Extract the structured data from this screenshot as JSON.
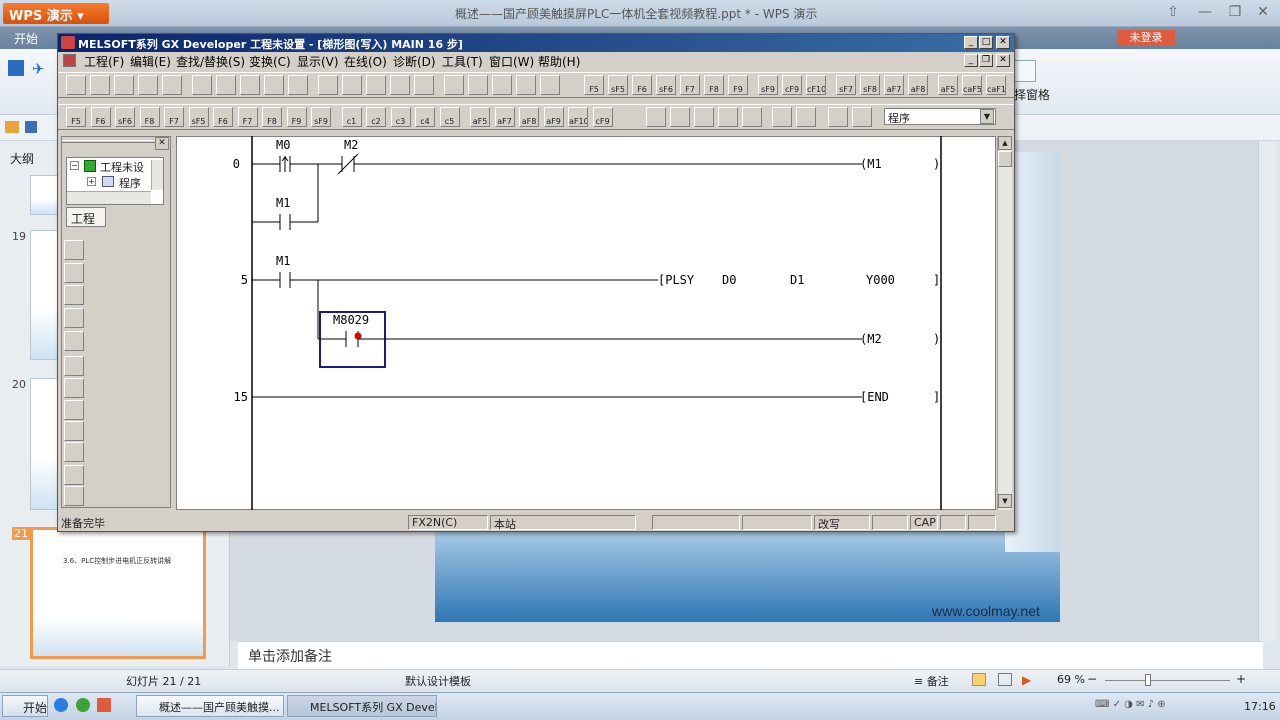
{
  "wps": {
    "app_button": "WPS 演示",
    "doc_title": "概述——国产顾美触摸屏PLC一体机全套视频教程.ppt * - WPS 演示",
    "menu_start": "开始",
    "login": "未登录",
    "ribbon_right_label": "择窗格",
    "outline_tab": "大纲",
    "slide_numbers": [
      "19",
      "20",
      "21"
    ],
    "thumb21_title": "3.6、PLC控制步进电机正反转讲解",
    "slide_site": "www.coolmay.net",
    "notes_placeholder": "单击添加备注",
    "status_slide": "幻灯片 21 / 21",
    "status_template": "默认设计模板",
    "status_notes": "备注",
    "zoom": "69 %"
  },
  "taskbar": {
    "start": "开始",
    "item1": "概述——国产顾美触摸...",
    "item2": "MELSOFT系列 GX Devel...",
    "clock": "17:16"
  },
  "gx": {
    "title": "MELSOFT系列 GX Developer 工程未设置 - [梯形图(写入)    MAIN    16 步]",
    "menu": [
      "工程(F)",
      "编辑(E)",
      "查找/替换(S)",
      "变换(C)",
      "显示(V)",
      "在线(O)",
      "诊断(D)",
      "工具(T)",
      "窗口(W)",
      "帮助(H)"
    ],
    "toolbar_keys": [
      "F5",
      "sF5",
      "F6",
      "sF6",
      "F7",
      "F8",
      "F9",
      "sF9",
      "cF9",
      "cF10",
      "sF7",
      "sF8",
      "aF7",
      "aF8",
      "aF5",
      "caF5",
      "caF10"
    ],
    "toolbar2_keys": [
      "F5",
      "F6",
      "sF6",
      "F8",
      "F7",
      "sF5",
      "F6",
      "F7",
      "F8",
      "F9",
      "sF9",
      "c1",
      "c2",
      "c3",
      "c4",
      "c5",
      "aF5",
      "aF7",
      "aF8",
      "aF9",
      "aF10",
      "cF9"
    ],
    "mode": "程序",
    "project": {
      "root": "工程未设",
      "child": "程序",
      "tab": "工程"
    },
    "ladder": {
      "steps": [
        "0",
        "5",
        "15"
      ],
      "contacts": {
        "r0_m0": "M0",
        "r0_m2": "M2",
        "r0_m1": "M1",
        "r5_m1": "M1",
        "r5_m8029": "M8029"
      },
      "coils": {
        "m1": "(M1",
        "m2": "(M2",
        "end": "[END",
        "plsy": "[PLSY",
        "d0": "D0",
        "d1": "D1",
        "y000": "Y000"
      },
      "bracket_close": ")",
      "bracket_close_sq": "]"
    },
    "status": {
      "ready": "准备完毕",
      "cpu": "FX2N(C)",
      "station": "本站",
      "mode": "改写",
      "caps": "CAP"
    }
  }
}
